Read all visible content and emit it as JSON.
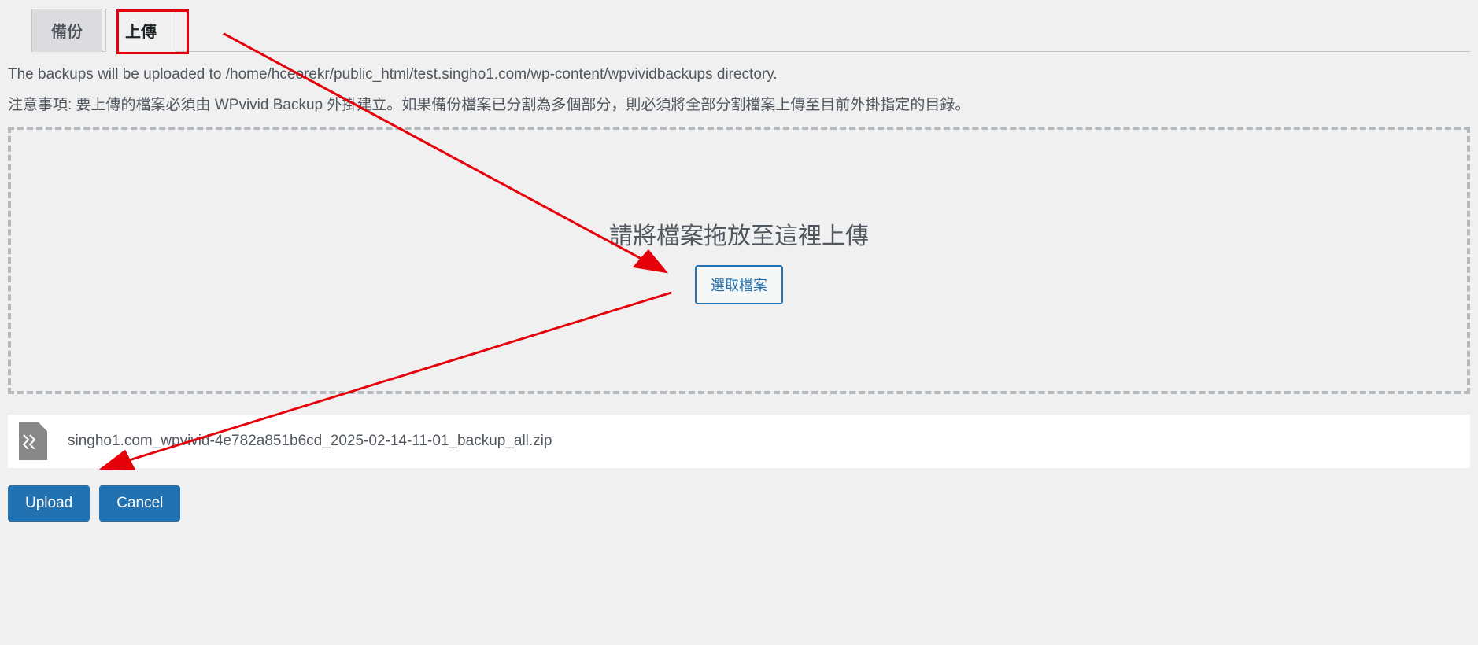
{
  "tabs": {
    "backup": "備份",
    "upload": "上傳"
  },
  "info": "The backups will be uploaded to /home/hceorekr/public_html/test.singho1.com/wp-content/wpvividbackups directory.",
  "notice": "注意事項: 要上傳的檔案必須由 WPvivid Backup 外掛建立。如果備份檔案已分割為多個部分，則必須將全部分割檔案上傳至目前外掛指定的目錄。",
  "dropzone": {
    "text": "請將檔案拖放至這裡上傳",
    "button": "選取檔案"
  },
  "file": {
    "name": "singho1.com_wpvivid-4e782a851b6cd_2025-02-14-11-01_backup_all.zip"
  },
  "buttons": {
    "upload": "Upload",
    "cancel": "Cancel"
  }
}
